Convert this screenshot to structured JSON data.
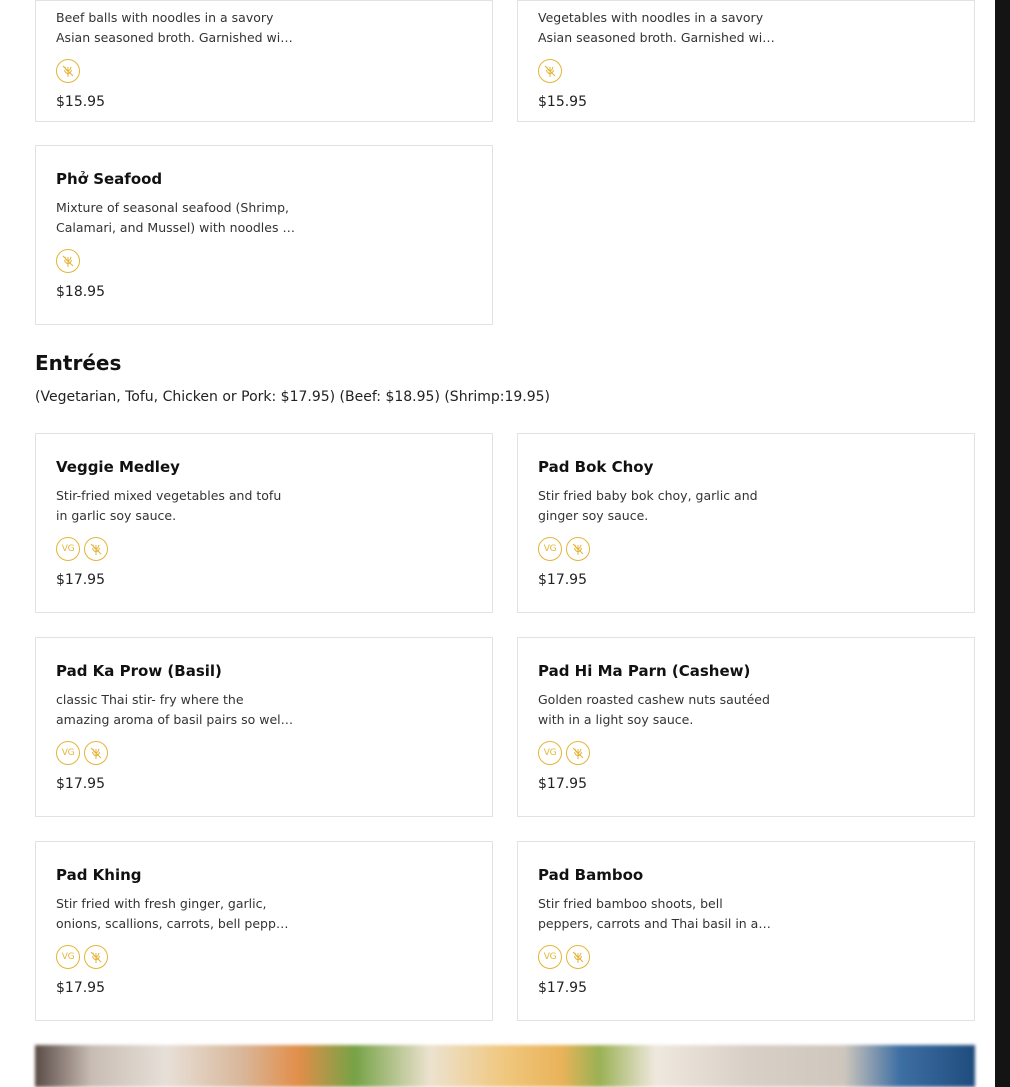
{
  "cards_top": [
    {
      "description": "Beef balls with noodles in a savory Asian seasoned broth. Garnished with fresh herbs.",
      "icons": [
        "gluten-free-icon"
      ],
      "price": "$15.95"
    },
    {
      "description": "Vegetables with noodles in a savory Asian seasoned broth. Garnished with fresh herbs.",
      "icons": [
        "gluten-free-icon"
      ],
      "price": "$15.95"
    },
    {
      "name": "Phở Seafood",
      "description": "Mixture of seasonal seafood (Shrimp, Calamari, and Mussel) with noodles in a savory broth.",
      "icons": [
        "gluten-free-icon"
      ],
      "price": "$18.95"
    }
  ],
  "entrees": {
    "title": "Entrées",
    "subtitle": "(Vegetarian, Tofu, Chicken or Pork: $17.95) (Beef: $18.95) (Shrimp:19.95)",
    "items": [
      {
        "name": "Veggie Medley",
        "description": "Stir-fried mixed vegetables and tofu in garlic soy sauce.",
        "icons": [
          "vegan-icon",
          "gluten-free-icon"
        ],
        "price": "$17.95"
      },
      {
        "name": "Pad Bok Choy",
        "description": "Stir fried baby bok choy, garlic and ginger soy sauce.",
        "icons": [
          "vegan-icon",
          "gluten-free-icon"
        ],
        "price": "$17.95"
      },
      {
        "name": "Pad Ka Prow (Basil)",
        "description": "classic Thai stir- fry where the amazing aroma of basil pairs so well with chili and garlic.",
        "icons": [
          "vegan-icon",
          "gluten-free-icon"
        ],
        "price": "$17.95"
      },
      {
        "name": "Pad Hi Ma Parn (Cashew)",
        "description": "Golden roasted cashew nuts sautéed with in a light soy sauce.",
        "icons": [
          "vegan-icon",
          "gluten-free-icon"
        ],
        "price": "$17.95"
      },
      {
        "name": "Pad Khing",
        "description": "Stir fried with fresh ginger, garlic, onions, scallions, carrots, bell peppers and mushrooms.",
        "icons": [
          "vegan-icon",
          "gluten-free-icon"
        ],
        "price": "$17.95"
      },
      {
        "name": "Pad Bamboo",
        "description": "Stir fried bamboo shoots, bell peppers, carrots and Thai basil in a chili sauce.",
        "icons": [
          "vegan-icon",
          "gluten-free-icon"
        ],
        "price": "$17.95"
      }
    ]
  },
  "icon_labels": {
    "vegan": "VG"
  },
  "colors": {
    "icon_accent": "#e3b437",
    "card_border": "#e2e2e2",
    "text": "#111111"
  }
}
